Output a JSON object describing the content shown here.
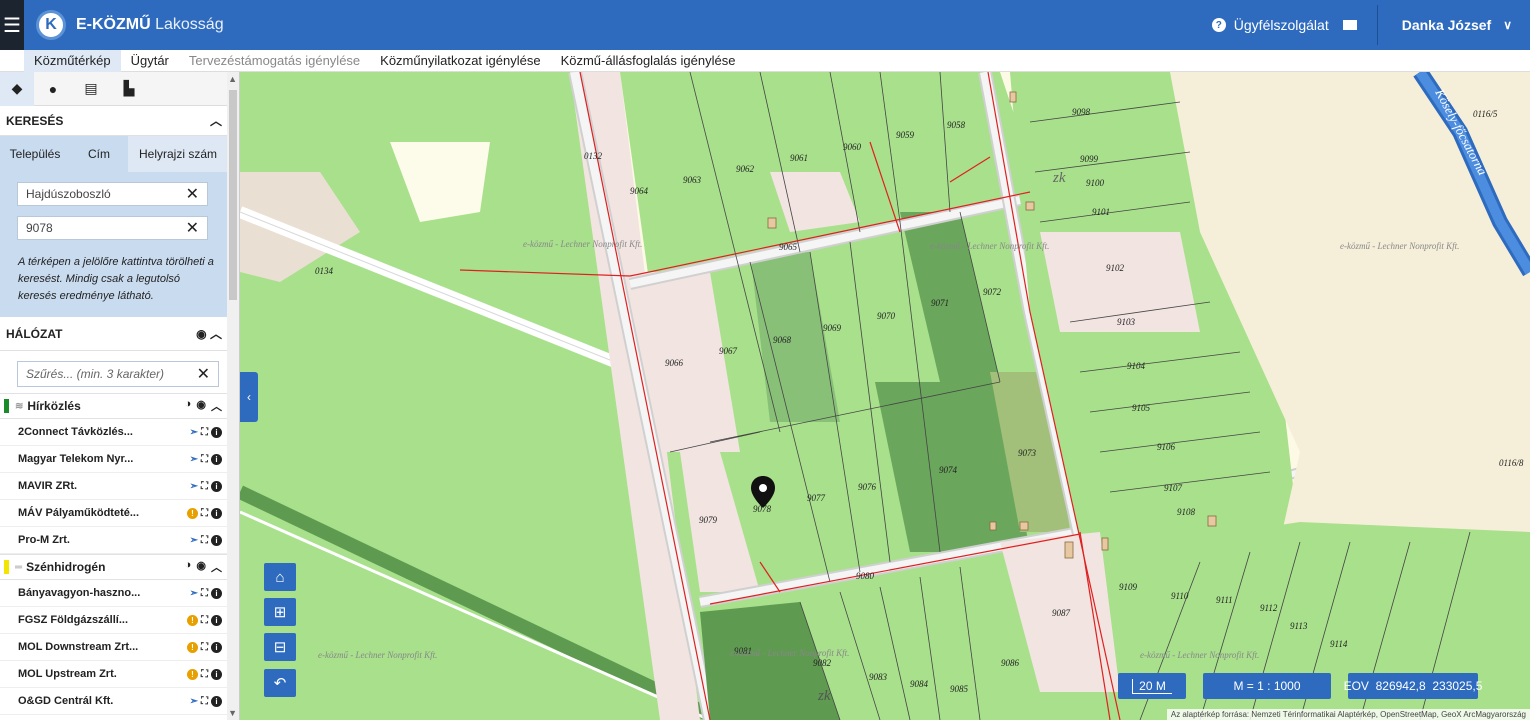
{
  "app": {
    "brand_bold": "E-KÖZMŰ",
    "brand_rest": "Lakosság",
    "logo_letter": "K"
  },
  "header": {
    "help_label": "Ügyfélszolgálat",
    "user_name": "Danka József"
  },
  "menu": [
    "Közműtérkép",
    "Ügytár",
    "Tervezéstámogatás igénylése",
    "Közműnyilatkozat igénylése",
    "Közmű-állásfoglalás igénylése"
  ],
  "search": {
    "title": "KERESÉS",
    "tabs": [
      "Település",
      "Cím",
      "Helyrajzi szám"
    ],
    "settlement_value": "Hajdúszoboszló",
    "parcel_value": "9078",
    "hint": "A térképen a jelölőre kattintva törölheti a keresést. Mindig csak a legutolsó keresés eredménye látható."
  },
  "network": {
    "title": "HÁLÓZAT",
    "filter_placeholder": "Szűrés... (min. 3 karakter)",
    "groups": [
      {
        "name": "Hírközlés",
        "color": "#1a8a2a",
        "items": [
          {
            "name": "2Connect Távközlés...",
            "status": "ok"
          },
          {
            "name": "Magyar Telekom Nyr...",
            "status": "ok"
          },
          {
            "name": "MAVIR ZRt.",
            "status": "ok"
          },
          {
            "name": "MÁV Pályaműködteté...",
            "status": "warn"
          },
          {
            "name": "Pro-M Zrt.",
            "status": "ok"
          }
        ]
      },
      {
        "name": "Szénhidrogén",
        "color": "#f2e600",
        "items": [
          {
            "name": "Bányavagyon-haszno...",
            "status": "ok"
          },
          {
            "name": "FGSZ Földgázszállí...",
            "status": "warn"
          },
          {
            "name": "MOL Downstream Zrt...",
            "status": "warn"
          },
          {
            "name": "MOL Upstream Zrt.",
            "status": "warn"
          },
          {
            "name": "O&GD Centrál Kft.",
            "status": "ok"
          }
        ]
      }
    ]
  },
  "map": {
    "scale_bar": "20 M",
    "scale_ratio": "M = 1 : 1000",
    "eov_label": "EOV",
    "eov_x": "826942,8",
    "eov_y": "233025,5",
    "attribution": "Az alaptérkép forrása: Nemzeti Térinformatikai Alaptérkép, OpenStreetMap, GeoX ArcMagyarország",
    "watermark": "e-közmű - Lechner Nonprofit Kft.",
    "canal_label": "Kösely-főcsatorna",
    "zk_label": "zk",
    "parcels": [
      "9098",
      "0116/5",
      "9099",
      "9100",
      "9101",
      "9102",
      "9103",
      "9104",
      "9105",
      "9106",
      "9107",
      "9108",
      "9109",
      "9110",
      "9111",
      "9112",
      "9113",
      "9114",
      "9058",
      "9059",
      "9060",
      "9061",
      "9062",
      "9063",
      "9064",
      "9065",
      "0132",
      "0134",
      "9066",
      "9067",
      "9068",
      "9069",
      "9070",
      "9071",
      "9072",
      "9073",
      "9074",
      "9076",
      "9077",
      "9078",
      "9079",
      "9080",
      "9081",
      "9082",
      "9083",
      "9084",
      "9085",
      "9086",
      "9087",
      "0116/8"
    ]
  }
}
